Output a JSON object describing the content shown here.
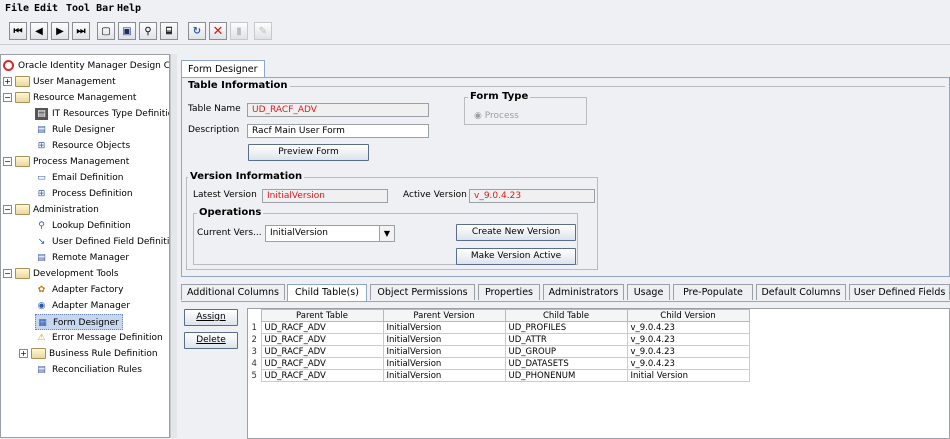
{
  "menu": [
    "File",
    "Edit",
    "Tool Bar",
    "Help"
  ],
  "toolbar": [
    "first-record-icon",
    "previous-record-icon",
    "next-record-icon",
    "last-record-icon",
    "new-icon",
    "save-icon",
    "find-icon",
    "query-icon",
    "refresh-icon",
    "delete-icon",
    "trash-icon",
    "edit-icon"
  ],
  "tree": {
    "root": "Oracle Identity Manager Design Cons",
    "nodes": [
      {
        "label": "User Management",
        "type": "folder-collapsed"
      },
      {
        "label": "Resource Management",
        "type": "folder-expanded"
      },
      {
        "label": "IT Resources Type Definitio",
        "icon": "it-resource-icon"
      },
      {
        "label": "Rule Designer",
        "icon": "rule-icon"
      },
      {
        "label": "Resource Objects",
        "icon": "resource-object-icon"
      },
      {
        "label": "Process Management",
        "type": "folder-expanded"
      },
      {
        "label": "Email Definition",
        "icon": "email-icon"
      },
      {
        "label": "Process Definition",
        "icon": "process-icon"
      },
      {
        "label": "Administration",
        "type": "folder-expanded"
      },
      {
        "label": "Lookup Definition",
        "icon": "lookup-icon"
      },
      {
        "label": "User Defined Field Definitio",
        "icon": "udf-icon"
      },
      {
        "label": "Remote Manager",
        "icon": "remote-manager-icon"
      },
      {
        "label": "Development Tools",
        "type": "folder-expanded"
      },
      {
        "label": "Adapter Factory",
        "icon": "adapter-factory-icon"
      },
      {
        "label": "Adapter Manager",
        "icon": "adapter-manager-icon"
      },
      {
        "label": "Form Designer",
        "icon": "form-designer-icon",
        "selected": true
      },
      {
        "label": "Error Message Definition",
        "icon": "warning-icon"
      },
      {
        "label": "Business Rule Definition",
        "type": "folder-collapsed"
      },
      {
        "label": "Reconciliation Rules",
        "icon": "reconciliation-icon"
      }
    ]
  },
  "form": {
    "tab": "Form Designer",
    "table_info_title": "Table Information",
    "table_name_label": "Table Name",
    "table_name": "UD_RACF_ADV",
    "description_label": "Description",
    "description": "Racf Main User Form",
    "preview_button": "Preview Form",
    "form_type_title": "Form Type",
    "form_type_option": "Process",
    "version_info_title": "Version Information",
    "latest_version_label": "Latest Version",
    "latest_version": "InitialVersion",
    "active_version_label": "Active Version",
    "active_version": "v_9.0.4.23",
    "operations_title": "Operations",
    "current_version_label": "Current Vers...",
    "current_version": "InitialVersion",
    "create_version_button": "Create New Version",
    "make_active_button": "Make Version Active"
  },
  "bottom_tabs": [
    "Additional Columns",
    "Child Table(s)",
    "Object Permissions",
    "Properties",
    "Administrators",
    "Usage",
    "Pre-Populate",
    "Default Columns",
    "User Defined Fields"
  ],
  "active_bottom_tab": "Child Table(s)",
  "buttons": {
    "assign": "Assign",
    "delete": "Delete"
  },
  "child_table": {
    "columns": [
      "Parent Table",
      "Parent Version",
      "Child Table",
      "Child Version"
    ],
    "rows": [
      [
        "1",
        "UD_RACF_ADV",
        "InitialVersion",
        "UD_PROFILES",
        "v_9.0.4.23"
      ],
      [
        "2",
        "UD_RACF_ADV",
        "InitialVersion",
        "UD_ATTR",
        "v_9.0.4.23"
      ],
      [
        "3",
        "UD_RACF_ADV",
        "InitialVersion",
        "UD_GROUP",
        "v_9.0.4.23"
      ],
      [
        "4",
        "UD_RACF_ADV",
        "InitialVersion",
        "UD_DATASETS",
        "v_9.0.4.23"
      ],
      [
        "5",
        "UD_RACF_ADV",
        "InitialVersion",
        "UD_PHONENUM",
        "Initial Version"
      ]
    ]
  }
}
